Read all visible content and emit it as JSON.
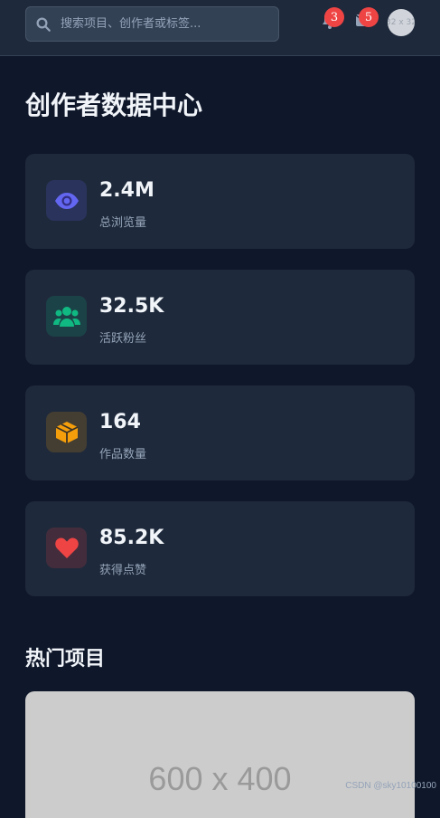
{
  "search": {
    "placeholder": "搜索项目、创作者或标签..."
  },
  "header": {
    "notifications": {
      "icon": "bell-icon",
      "count": "3"
    },
    "messages": {
      "icon": "envelope-icon",
      "count": "5"
    },
    "avatar": {
      "text": "32 x 32"
    }
  },
  "page": {
    "title": "创作者数据中心"
  },
  "stats": [
    {
      "icon": "eye-icon",
      "value": "2.4M",
      "label": "总浏览量",
      "color": "#6366f1"
    },
    {
      "icon": "users-icon",
      "value": "32.5K",
      "label": "活跃粉丝",
      "color": "#10b981"
    },
    {
      "icon": "box-icon",
      "value": "164",
      "label": "作品数量",
      "color": "#f59e0b"
    },
    {
      "icon": "heart-icon",
      "value": "85.2K",
      "label": "获得点赞",
      "color": "#ef4444"
    }
  ],
  "hot_projects": {
    "title": "热门项目",
    "image_placeholder": "600 x 400"
  },
  "watermark": "CSDN @sky10100100"
}
